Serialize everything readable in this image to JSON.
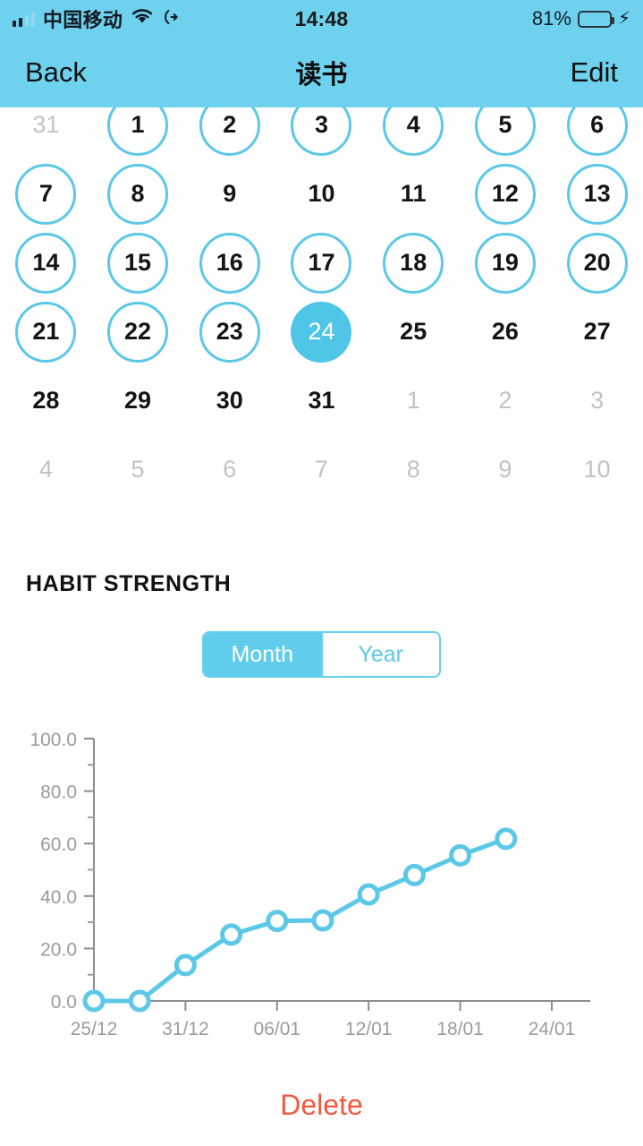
{
  "statusbar": {
    "carrier": "中国移动",
    "time": "14:48",
    "battery_pct": "81%",
    "wifi_icon": "wifi-icon",
    "location_icon": "location-arrow-icon",
    "charging_icon": "lightning-bolt-icon"
  },
  "navbar": {
    "back_label": "Back",
    "title": "读书",
    "edit_label": "Edit"
  },
  "theme": {
    "accent": "#6ed2ef",
    "ring": "#5cc8e8",
    "selected_fill": "#4fc6e8",
    "delete_color": "#f4573e",
    "muted_text": "#bfc3c6",
    "line_color": "#5bc8e8"
  },
  "calendar": {
    "days": [
      {
        "label": "31",
        "state": "muted"
      },
      {
        "label": "1",
        "state": "ring"
      },
      {
        "label": "2",
        "state": "ring"
      },
      {
        "label": "3",
        "state": "ring"
      },
      {
        "label": "4",
        "state": "ring"
      },
      {
        "label": "5",
        "state": "ring"
      },
      {
        "label": "6",
        "state": "ring"
      },
      {
        "label": "7",
        "state": "ring"
      },
      {
        "label": "8",
        "state": "ring"
      },
      {
        "label": "9",
        "state": "plain"
      },
      {
        "label": "10",
        "state": "plain"
      },
      {
        "label": "11",
        "state": "plain"
      },
      {
        "label": "12",
        "state": "ring"
      },
      {
        "label": "13",
        "state": "ring"
      },
      {
        "label": "14",
        "state": "ring"
      },
      {
        "label": "15",
        "state": "ring"
      },
      {
        "label": "16",
        "state": "ring"
      },
      {
        "label": "17",
        "state": "ring"
      },
      {
        "label": "18",
        "state": "ring"
      },
      {
        "label": "19",
        "state": "ring"
      },
      {
        "label": "20",
        "state": "ring"
      },
      {
        "label": "21",
        "state": "ring"
      },
      {
        "label": "22",
        "state": "ring"
      },
      {
        "label": "23",
        "state": "ring"
      },
      {
        "label": "24",
        "state": "selected"
      },
      {
        "label": "25",
        "state": "plain"
      },
      {
        "label": "26",
        "state": "plain"
      },
      {
        "label": "27",
        "state": "plain"
      },
      {
        "label": "28",
        "state": "plain"
      },
      {
        "label": "29",
        "state": "plain"
      },
      {
        "label": "30",
        "state": "plain"
      },
      {
        "label": "31",
        "state": "plain"
      },
      {
        "label": "1",
        "state": "muted"
      },
      {
        "label": "2",
        "state": "muted"
      },
      {
        "label": "3",
        "state": "muted"
      },
      {
        "label": "4",
        "state": "muted"
      },
      {
        "label": "5",
        "state": "muted"
      },
      {
        "label": "6",
        "state": "muted"
      },
      {
        "label": "7",
        "state": "muted"
      },
      {
        "label": "8",
        "state": "muted"
      },
      {
        "label": "9",
        "state": "muted"
      },
      {
        "label": "10",
        "state": "muted"
      }
    ]
  },
  "habit_strength": {
    "title": "HABIT STRENGTH",
    "segments": [
      {
        "label": "Month",
        "active": true
      },
      {
        "label": "Year",
        "active": false
      }
    ]
  },
  "footer": {
    "delete_label": "Delete"
  },
  "chart_data": {
    "type": "line",
    "title": "HABIT STRENGTH",
    "xlabel": "",
    "ylabel": "",
    "ylim": [
      0,
      100
    ],
    "yticks": [
      "0.0",
      "20.0",
      "40.0",
      "60.0",
      "80.0",
      "100.0"
    ],
    "ytick_values": [
      0,
      20,
      40,
      60,
      80,
      100
    ],
    "yminor_values": [
      10,
      30,
      50,
      70,
      90
    ],
    "xticks": [
      "25/12",
      "31/12",
      "06/01",
      "12/01",
      "18/01",
      "24/01"
    ],
    "grid": false,
    "legend": "none",
    "x": [
      "28/12",
      "31/12",
      "03/01",
      "06/01",
      "09/01",
      "12/01",
      "15/01",
      "18/01",
      "21/01",
      "24/01"
    ],
    "values": [
      0.0,
      0.0,
      13.7,
      25.3,
      30.5,
      30.7,
      40.6,
      48.0,
      55.5,
      61.8
    ],
    "series": [
      {
        "name": "Habit strength",
        "values": [
          0.0,
          0.0,
          13.7,
          25.3,
          30.5,
          30.7,
          40.6,
          48.0,
          55.5,
          61.8
        ]
      }
    ]
  }
}
